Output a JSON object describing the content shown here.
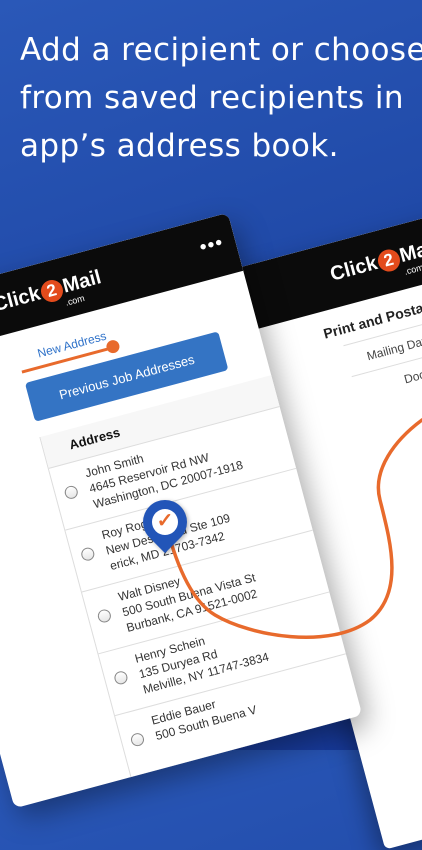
{
  "headline": {
    "line1": "Add a recipient or choose",
    "line2": "from saved recipients in",
    "line3": "app’s address book."
  },
  "brand": {
    "logo_left": "Click",
    "logo_badge": "2",
    "logo_right": "Mail",
    "logo_suffix": ".com",
    "colors": {
      "accent_orange": "#e86a2c",
      "button_blue": "#3474c4",
      "background_blue": "#1f48a6"
    }
  },
  "back_phone": {
    "section_title": "Print and Postage",
    "row1": "Mailing Date",
    "row2": "Docum"
  },
  "front_phone": {
    "menu_icon": "more-dots-icon",
    "new_address_link": "New Address",
    "previous_button": "Previous Job Addresses",
    "list_header": "Address",
    "addresses": [
      {
        "name": "John Smith",
        "line1": "4645 Reservoir Rd NW",
        "line2": "Washington, DC 20007-1918"
      },
      {
        "name": "Roy Rogers",
        "line1": "New Design Rd Ste 109",
        "line2": "erick, MD 21703-7342"
      },
      {
        "name": "Walt Disney",
        "line1": "500 South Buena Vista St",
        "line2": "Burbank, CA 91521-0002"
      },
      {
        "name": "Henry Schein",
        "line1": "135 Duryea Rd",
        "line2": "Melville, NY 11747-3834"
      },
      {
        "name": "Eddie Bauer",
        "line1": "500 South Buena V",
        "line2": ""
      }
    ]
  },
  "pin_icon": "location-check-pin-icon"
}
